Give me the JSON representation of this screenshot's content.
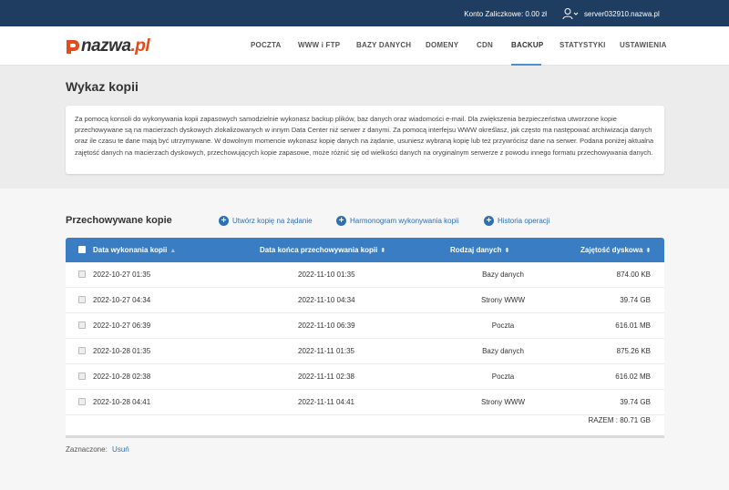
{
  "topbar": {
    "account": "Konto Zaliczkowe: 0.00 zł",
    "server": "server032910.nazwa.pl",
    "user_icon": "user-icon"
  },
  "logo": {
    "name": "nazwa",
    "suffix": ".pl"
  },
  "nav": {
    "items": [
      {
        "label": "POCZTA"
      },
      {
        "label": "WWW i FTP"
      },
      {
        "label": "BAZY DANYCH"
      },
      {
        "label": "DOMENY"
      },
      {
        "label": "CDN"
      },
      {
        "label": "BACKUP"
      },
      {
        "label": "STATYSTYKI"
      },
      {
        "label": "USTAWIENIA"
      }
    ],
    "active": "BACKUP",
    "accent": "#4a8fd0"
  },
  "page": {
    "title": "Wykaz kopii",
    "description": "Za pomocą konsoli do wykonywania kopii zapasowych samodzielnie wykonasz backup plików, baz danych oraz wiadomości e-mail. Dla zwiększenia bezpieczeństwa utworzone kopie przechowywane są na macierzach dyskowych zlokalizowanych w innym Data Center niż serwer z danymi. Za pomocą interfejsu WWW określasz, jak często ma następować archiwizacja danych oraz ile czasu te dane mają być utrzymywane. W dowolnym momencie wykonasz kopię danych na żądanie, usuniesz wybraną kopię lub też przywrócisz dane na serwer. Podana poniżej aktualna zajętość danych na macierzach dyskowych, przechowujących kopie zapasowe, może różnić się od wielkości danych na oryginalnym serwerze z powodu innego formatu przechowywania danych."
  },
  "backups": {
    "title": "Przechowywane kopie",
    "actions": [
      {
        "label": "Utwórz kopię na żądanie"
      },
      {
        "label": "Harmonogram wykonywania kopii"
      },
      {
        "label": "Historia operacji"
      }
    ],
    "columns": [
      {
        "label": "Data wykonania kopii"
      },
      {
        "label": "Data końca przechowywania kopii"
      },
      {
        "label": "Rodzaj danych"
      },
      {
        "label": "Zajętość dyskowa"
      }
    ],
    "rows": [
      {
        "date": "2022-10-27 01:35",
        "end": "2022-11-10 01:35",
        "type": "Bazy danych",
        "size": "874.00  KB"
      },
      {
        "date": "2022-10-27 04:34",
        "end": "2022-11-10 04:34",
        "type": "Strony WWW",
        "size": "39.74  GB"
      },
      {
        "date": "2022-10-27 06:39",
        "end": "2022-11-10 06:39",
        "type": "Poczta",
        "size": "616.01 MB"
      },
      {
        "date": "2022-10-28 01:35",
        "end": "2022-11-11 01:35",
        "type": "Bazy danych",
        "size": "875.26  KB"
      },
      {
        "date": "2022-10-28 02:38",
        "end": "2022-11-11 02:38",
        "type": "Poczta",
        "size": "616.02 MB"
      },
      {
        "date": "2022-10-28 04:41",
        "end": "2022-11-11 04:41",
        "type": "Strony WWW",
        "size": "39.74  GB"
      }
    ],
    "total": "RAZEM : 80.71  GB",
    "header_color": "#3a7dc3"
  },
  "footer": {
    "selected_label": "Zaznaczone:",
    "delete_link": "Usuń"
  }
}
